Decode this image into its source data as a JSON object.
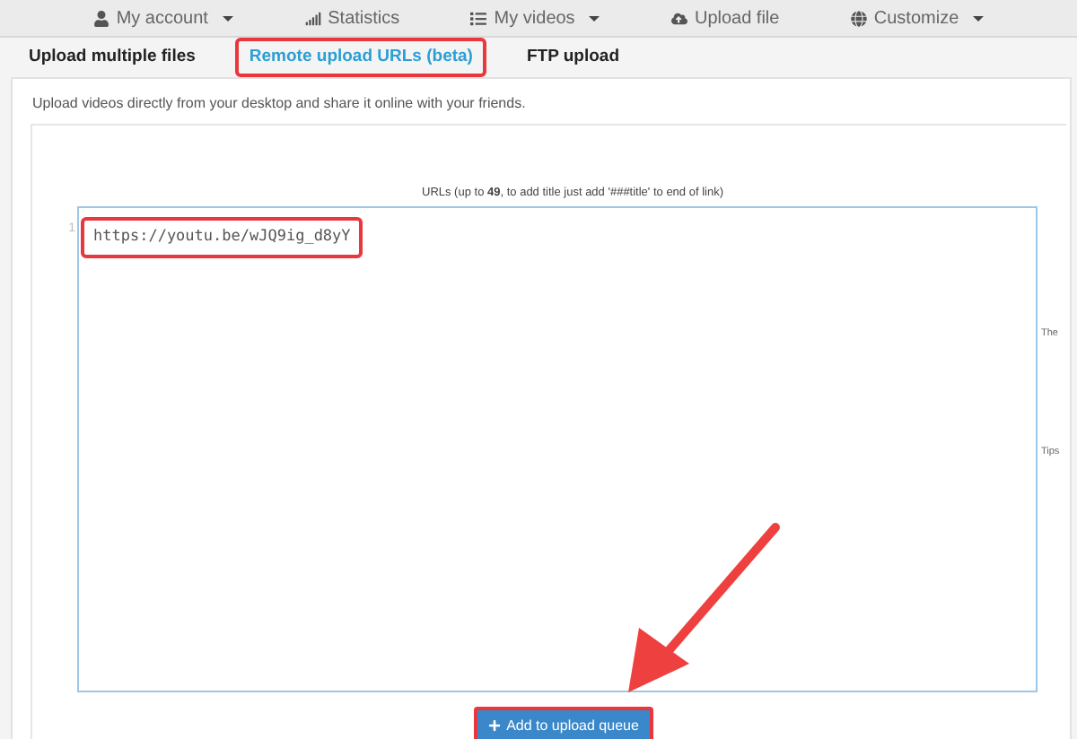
{
  "nav": [
    {
      "label": "My account",
      "kind": "account",
      "dropdown": true
    },
    {
      "label": "Statistics",
      "kind": "stats",
      "dropdown": false
    },
    {
      "label": "My videos",
      "kind": "videos",
      "dropdown": true
    },
    {
      "label": "Upload file",
      "kind": "upload",
      "dropdown": false
    },
    {
      "label": "Customize",
      "kind": "customize",
      "dropdown": true
    }
  ],
  "tabs": [
    {
      "label": "Upload multiple files",
      "selected": false,
      "highlighted": false
    },
    {
      "label": "Remote upload URLs (beta)",
      "selected": true,
      "highlighted": true
    },
    {
      "label": "FTP upload",
      "selected": false,
      "highlighted": false
    }
  ],
  "description": "Upload videos directly from your desktop and share it online with your friends.",
  "urls_label": "URLs (up to **49**, to add title just add '###title' to end of link)",
  "editor": {
    "line_number": "1",
    "value": "https://youtu.be/wJQ9ig_d8yY",
    "highlighted": true
  },
  "side_notes": [
    "The",
    "Tips"
  ],
  "button": {
    "label": "Add to upload queue",
    "highlighted": true
  }
}
